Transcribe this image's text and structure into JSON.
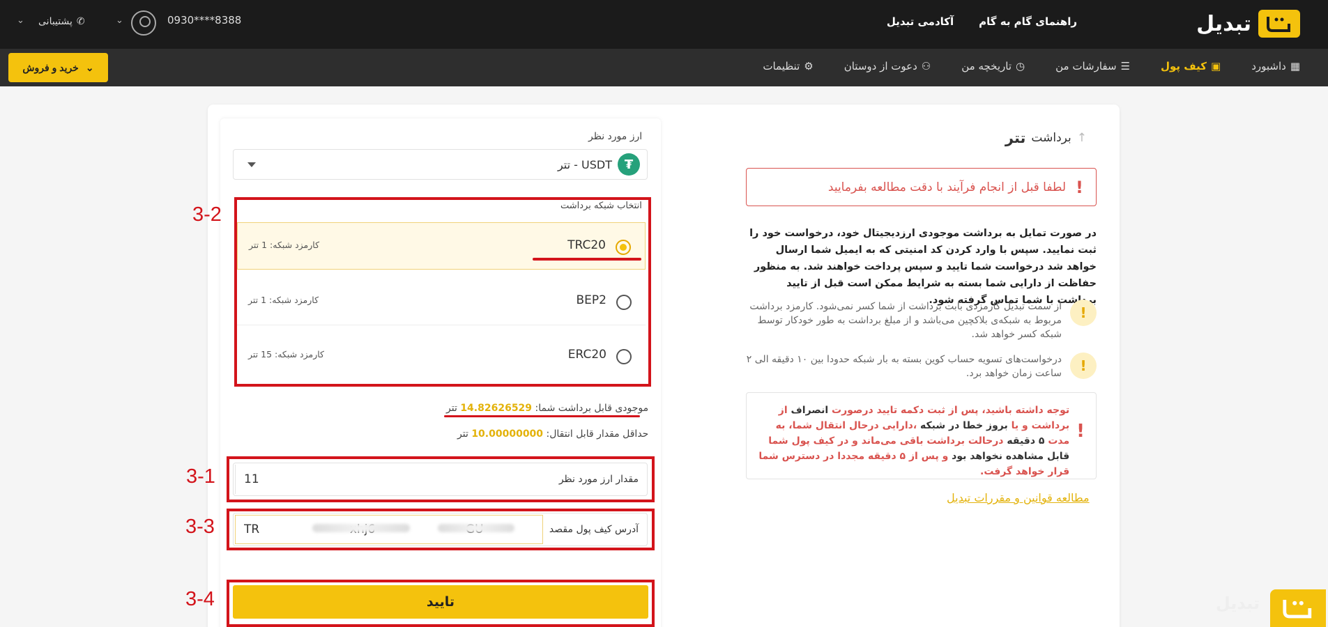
{
  "header": {
    "brand": "تبدیل",
    "nav": [
      "راهنمای گام به گام",
      "آکادمی تبدیل"
    ],
    "phone": "0930****8388",
    "support": "پشتیبانی"
  },
  "subnav": {
    "items": [
      {
        "label": "داشبورد",
        "icon": "dashboard-icon"
      },
      {
        "label": "کیف پول",
        "icon": "wallet-icon",
        "active": true
      },
      {
        "label": "سفارشات من",
        "icon": "orders-icon"
      },
      {
        "label": "تاریخچه من",
        "icon": "history-icon"
      },
      {
        "label": "دعوت از دوستان",
        "icon": "users-icon"
      },
      {
        "label": "تنظیمات",
        "icon": "gear-icon"
      }
    ],
    "buy_sell": "خرید و فروش"
  },
  "info": {
    "title_prefix": "برداشت",
    "title_coin": "تتر",
    "alert": "لطفا قبل از انجام فرآیند با دقت مطالعه بفرمایید",
    "description": "در صورت تمایل به برداشت موجودی ارزدیجیتال خود، درخواست خود را ثبت نمایید. سپس با وارد کردن کد امنیتی که به ایمیل شما ارسال خواهد شد درخواست شما تایید و سپس پرداخت خواهند شد. به منظور حفاظت از دارایی شما بسته به شرایط ممکن است قبل از تایید برداشت با شما تماس گرفته شود.",
    "note1": "از سمت تبدیل کارمزدی بابت برداشت از شما کسر نمی‌شود. کارمزد برداشت مربوط به شبکه‌ی بلاکچین می‌باشد و از مبلغ برداشت به طور خودکار توسط شبکه کسر خواهد شد.",
    "note2": "درخواست‌های تسویه حساب کوین بسته به بار شبکه حدودا بین ۱۰ دقیقه الی ۲ ساعت زمان خواهد برد.",
    "warn": {
      "p1": "توجه داشته باشید، پس از ثبت دکمه تایید درصورت",
      "p2": "انصراف",
      "p3": "از برداشت و یا",
      "p4": "بروز خطا در شبکه",
      "p5": "،دارایی درحال انتقال شما، به مدت",
      "p6": "۵ دقیقه",
      "p7": "درحالت برداشت باقی می‌ماند و در کیف پول شما",
      "p8": "قابل مشاهده نخواهد بود",
      "p9": "و پس از",
      "p10": "۵ دقیقه مجددا در دسترس شما قرار خواهد گرفت."
    },
    "rules_link": "مطالعه قوانین و مقررات تبدیل"
  },
  "form": {
    "currency_label": "ارز مورد نظر",
    "currency_value": "USDT - تتر",
    "network_label": "انتخاب شبکه برداشت",
    "networks": [
      {
        "name": "TRC20",
        "fee": "کارمزد شبکه: 1 تتر",
        "selected": true
      },
      {
        "name": "BEP2",
        "fee": "کارمزد شبکه: 1 تتر",
        "selected": false
      },
      {
        "name": "ERC20",
        "fee": "کارمزد شبکه: 15 تتر",
        "selected": false
      }
    ],
    "balance_label": "موجودی قابل برداشت شما:",
    "balance_value": "14.82626529",
    "balance_unit": "تتر",
    "min_label": "حداقل مقدار قابل انتقال:",
    "min_value": "10.00000000",
    "min_unit": "تتر",
    "amount_label": "مقدار ارز مورد نظر",
    "amount_value": "11",
    "address_label": "آدرس کیف پول مقصد",
    "address_value": "TR                        xhj6                        GU",
    "submit": "تایید"
  },
  "steps": [
    "3-2",
    "3-1",
    "3-3",
    "3-4"
  ],
  "colors": {
    "accent": "#f4c20d",
    "annotation": "#d3141b",
    "dark": "#1b1b1b"
  }
}
